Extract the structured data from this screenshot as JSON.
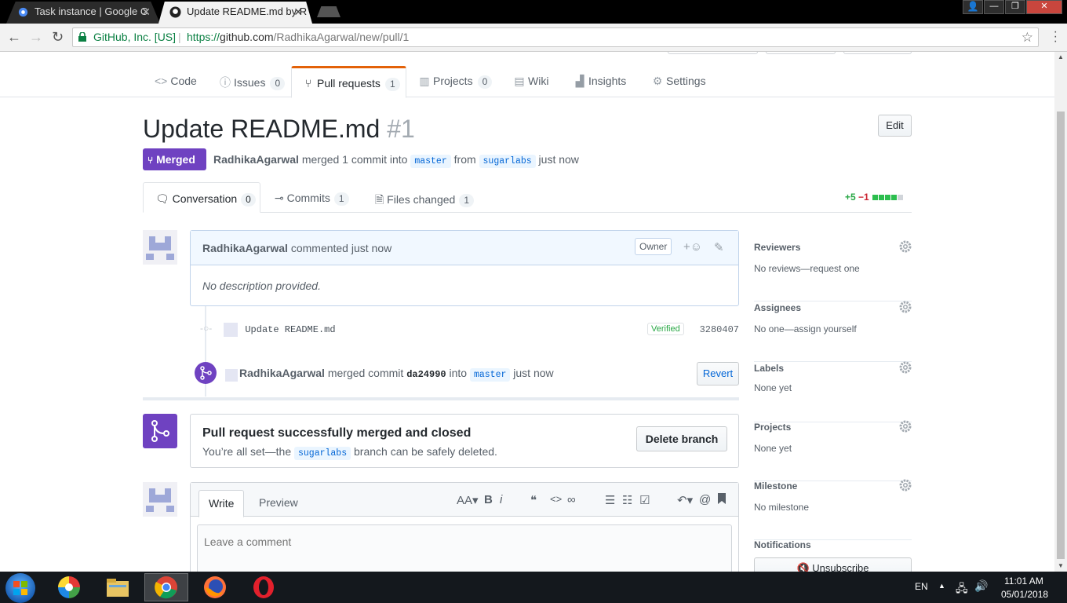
{
  "browser": {
    "tabs": [
      {
        "label": "Task instance | Google C",
        "icon": "gear-favicon-icon",
        "active": false
      },
      {
        "label": "Update README.md by R",
        "icon": "github-favicon-icon",
        "active": true
      }
    ],
    "close_glyph": "✕",
    "window_buttons": {
      "minimize": "—",
      "maximize": "❐",
      "close": "✕"
    },
    "address": {
      "org": "GitHub, Inc. [US]",
      "separator": "|",
      "url_proto": "https://",
      "url_host": "github.com",
      "url_path": "/RadhikaAgarwal/new/pull/1"
    }
  },
  "repo_nav": [
    {
      "label": "Code",
      "icon": "<>",
      "count": ""
    },
    {
      "label": "Issues",
      "icon": "ⓘ",
      "count": "0"
    },
    {
      "label": "Pull requests",
      "icon": "⑂",
      "count": "1"
    },
    {
      "label": "Projects",
      "icon": "▥",
      "count": "0"
    },
    {
      "label": "Wiki",
      "icon": "▤",
      "count": ""
    },
    {
      "label": "Insights",
      "icon": "▟",
      "count": ""
    },
    {
      "label": "Settings",
      "icon": "⚙",
      "count": ""
    }
  ],
  "pr": {
    "title": "Update README.md",
    "number": "#1",
    "edit_label": "Edit",
    "state": "Merged",
    "author": "RadhikaAgarwal",
    "merged_text": "merged 1 commit into",
    "base_branch": "master",
    "from_text": "from",
    "head_branch": "sugarlabs",
    "when": "just now"
  },
  "pr_tabs": [
    {
      "label": "Conversation",
      "count": "0"
    },
    {
      "label": "Commits",
      "count": "1"
    },
    {
      "label": "Files changed",
      "count": "1"
    }
  ],
  "diffstat": {
    "additions": "+5",
    "deletions": "−1"
  },
  "comment": {
    "author": "RadhikaAgarwal",
    "action": "commented just now",
    "role": "Owner",
    "body": "No description provided."
  },
  "commit": {
    "message": "Update README.md",
    "badge": "Verified",
    "sha": "3280407"
  },
  "merge_event": {
    "author": "RadhikaAgarwal",
    "text": "merged commit",
    "sha": "da24990",
    "into": "into",
    "branch": "master",
    "when": "just now",
    "revert_label": "Revert"
  },
  "merge_box": {
    "heading": "Pull request successfully merged and closed",
    "text_before": "You’re all set—the",
    "branch": "sugarlabs",
    "text_after": "branch can be safely deleted.",
    "button": "Delete branch"
  },
  "composer": {
    "write_tab": "Write",
    "preview_tab": "Preview",
    "placeholder": "Leave a comment",
    "toolbar": {
      "heading": "AA▾",
      "bold": "B",
      "italic": "i",
      "quote": "❝",
      "code": "<>",
      "link": "∞",
      "bullets": "☰",
      "numbered": "☷",
      "tasks": "☑",
      "reply": "↶▾",
      "mention": "@",
      "bookmark": "🔖"
    }
  },
  "sidebar": [
    {
      "title": "Reviewers",
      "value": "No reviews—request one"
    },
    {
      "title": "Assignees",
      "value": "No one—assign yourself"
    },
    {
      "title": "Labels",
      "value": "None yet"
    },
    {
      "title": "Projects",
      "value": "None yet"
    },
    {
      "title": "Milestone",
      "value": "No milestone"
    },
    {
      "title": "Notifications",
      "value": ""
    }
  ],
  "unsubscribe_label": "Unsubscribe",
  "taskbar": {
    "language": "EN",
    "time": "11:01 AM",
    "date": "05/01/2018"
  },
  "colors": {
    "merged_purple": "#6f42c1",
    "link_blue": "#0366d6",
    "tab_accent": "#e36209",
    "addition_green": "#28a745",
    "deletion_red": "#cb2431"
  }
}
